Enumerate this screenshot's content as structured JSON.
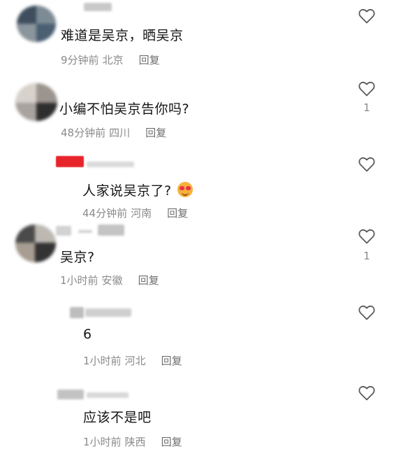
{
  "comments": [
    {
      "text": "难道是吴京，晒吴京",
      "time": "9分钟前",
      "location": "北京",
      "reply_label": "回复",
      "like_count": "",
      "like_icon": "heart-outline-icon"
    },
    {
      "text": "小编不怕吴京告你吗?",
      "time": "48分钟前",
      "location": "四川",
      "reply_label": "回复",
      "like_count": "1",
      "like_icon": "heart-outline-icon"
    },
    {
      "text": "人家说吴京了?",
      "emoji": "heart-eyes-emoji",
      "time": "44分钟前",
      "location": "河南",
      "reply_label": "回复",
      "like_count": "",
      "like_icon": "heart-outline-icon"
    },
    {
      "text": "吴京?",
      "time": "1小时前",
      "location": "安徽",
      "reply_label": "回复",
      "like_count": "1",
      "like_icon": "heart-outline-icon"
    },
    {
      "text": "6",
      "time": "1小时前",
      "location": "河北",
      "reply_label": "回复",
      "like_count": "",
      "like_icon": "heart-outline-icon"
    },
    {
      "text": "应该不是吧",
      "time": "1小时前",
      "location": "陕西",
      "reply_label": "回复",
      "like_count": "",
      "like_icon": "heart-outline-icon"
    }
  ],
  "colors": {
    "text": "#161616",
    "meta": "#8a8a8a",
    "reply_name_red": "#e8242b",
    "emoji_face": "#f6b13c"
  }
}
